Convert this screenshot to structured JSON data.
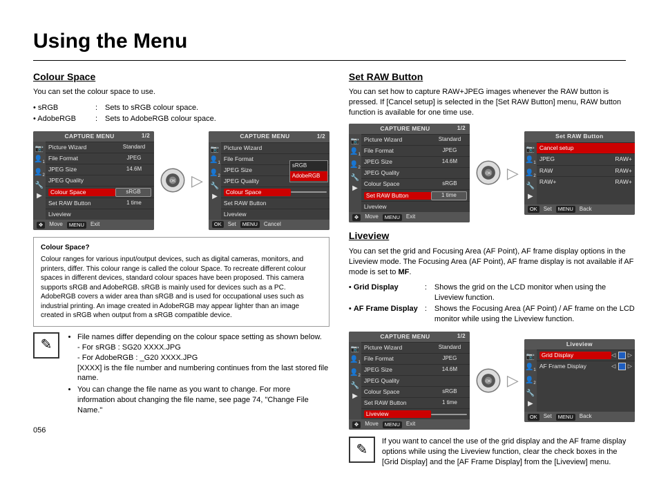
{
  "page": {
    "title": "Using the Menu",
    "number": "056"
  },
  "left": {
    "colourSpace": {
      "title": "Colour Space",
      "intro": "You can set the colour space to use.",
      "defs": [
        {
          "term": "• sRGB",
          "colon": ":",
          "desc": "Sets to sRGB colour space."
        },
        {
          "term": "• AdobeRGB",
          "colon": ":",
          "desc": "Sets to AdobeRGB colour space."
        }
      ],
      "menu1": {
        "head": "CAPTURE MENU",
        "page": "1/2",
        "rows": [
          {
            "label": "Picture Wizard",
            "val": "Standard"
          },
          {
            "label": "File Format",
            "val": "JPEG"
          },
          {
            "label": "JPEG Size",
            "val": "14.6M"
          },
          {
            "label": "JPEG Quality",
            "val": ""
          },
          {
            "label": "Colour Space",
            "val": "sRGB",
            "sel": true
          },
          {
            "label": "Set RAW Button",
            "val": "1 time"
          },
          {
            "label": "Liveview",
            "val": ""
          }
        ],
        "foot": {
          "l": "Move",
          "r": "Exit"
        }
      },
      "menu2": {
        "head": "CAPTURE MENU",
        "page": "1/2",
        "rows": [
          {
            "label": "Picture Wizard",
            "val": ""
          },
          {
            "label": "File Format",
            "val": ""
          },
          {
            "label": "JPEG Size",
            "val": ""
          },
          {
            "label": "JPEG Quality",
            "val": ""
          },
          {
            "label": "Colour Space",
            "val": "",
            "sel": true
          },
          {
            "label": "Set RAW Button",
            "val": ""
          },
          {
            "label": "Liveview",
            "val": ""
          }
        ],
        "popup": [
          "sRGB",
          "AdobeRGB"
        ],
        "foot": {
          "l": "Set",
          "r": "Cancel"
        }
      },
      "box": {
        "title": "Colour Space?",
        "text": "Colour ranges for various input/output devices, such as digital cameras, monitors, and printers, differ. This colour range is called the colour Space. To recreate different colour spaces in different devices, standard colour spaces have been proposed. This camera supports sRGB and AdobeRGB. sRGB is mainly used for devices such as a PC. AdobeRGB covers a wider area than sRGB and is used for occupational uses such as industrial printing. An image created in AdobeRGB may appear lighter than an image created in sRGB when output from a sRGB compatible device."
      },
      "note": {
        "bullet1": "File names differ depending on the colour space setting as shown below.",
        "sub1": "- For sRGB : SG20 XXXX.JPG",
        "sub2": "- For AdobeRGB : _G20 XXXX.JPG",
        "sub3": "[XXXX] is the file number and numbering continues from the last stored file name.",
        "bullet2": "You can change the file name as you want to change. For more information about changing the file name, see page 74, \"Change File Name.\""
      }
    }
  },
  "right": {
    "setRaw": {
      "title": "Set RAW Button",
      "intro": "You can set how to capture RAW+JPEG images whenever the RAW button is pressed. If [Cancel setup] is selected in the [Set RAW Button] menu, RAW button function is available for one time use.",
      "menu": {
        "head": "CAPTURE MENU",
        "page": "1/2",
        "rows": [
          {
            "label": "Picture Wizard",
            "val": "Standard"
          },
          {
            "label": "File Format",
            "val": "JPEG"
          },
          {
            "label": "JPEG Size",
            "val": "14.6M"
          },
          {
            "label": "JPEG Quality",
            "val": ""
          },
          {
            "label": "Colour Space",
            "val": "sRGB"
          },
          {
            "label": "Set RAW Button",
            "val": "1 time",
            "sel": true
          },
          {
            "label": "Liveview",
            "val": ""
          }
        ],
        "foot": {
          "l": "Move",
          "r": "Exit"
        }
      },
      "submenu": {
        "head": "Set RAW Button",
        "rows": [
          {
            "label": "Cancel setup",
            "val": "",
            "sel": true
          },
          {
            "label": "JPEG",
            "val": "RAW+"
          },
          {
            "label": "RAW",
            "val": "RAW+"
          },
          {
            "label": "RAW+",
            "val": "RAW+"
          }
        ],
        "foot": {
          "l": "Set",
          "r": "Back"
        }
      }
    },
    "liveview": {
      "title": "Liveview",
      "intro": "You can set the grid and Focusing Area (AF Point), AF frame display options in the Liveview mode. The Focusing Area (AF Point), AF frame display is not available if AF mode is set to ",
      "introBold": "MF",
      "introEnd": ".",
      "defs": [
        {
          "termBold": "Grid Display",
          "colon": ":",
          "desc": "Shows the grid on the LCD monitor when using the Liveview function."
        },
        {
          "termBold": "AF Frame Display",
          "colon": ":",
          "desc": "Shows the Focusing Area (AF Point) / AF frame on the LCD monitor while using the Liveview function."
        }
      ],
      "menu": {
        "head": "CAPTURE MENU",
        "page": "1/2",
        "rows": [
          {
            "label": "Picture Wizard",
            "val": "Standard"
          },
          {
            "label": "File Format",
            "val": "JPEG"
          },
          {
            "label": "JPEG Size",
            "val": "14.6M"
          },
          {
            "label": "JPEG Quality",
            "val": ""
          },
          {
            "label": "Colour Space",
            "val": "sRGB"
          },
          {
            "label": "Set RAW Button",
            "val": "1 time"
          },
          {
            "label": "Liveview",
            "val": "",
            "sel": true
          }
        ],
        "foot": {
          "l": "Move",
          "r": "Exit"
        }
      },
      "submenu": {
        "head": "Liveview",
        "rows": [
          {
            "label": "Grid Display",
            "chk": true,
            "sel": true
          },
          {
            "label": "AF Frame Display",
            "chk": true
          }
        ],
        "foot": {
          "l": "Set",
          "r": "Back"
        }
      },
      "note": "If you want to cancel the use of the grid display and the AF frame display options while using the Liveview function, clear the check boxes in the [Grid Display] and the [AF Frame Display] from the [Liveview] menu."
    }
  },
  "glyphs": {
    "ok": "OK",
    "menu": "MENU",
    "pencil": "✎",
    "camera": "📷",
    "person": "👤",
    "play": "▶",
    "wrench": "🔧",
    "arrows4": "✥",
    "arrowR": "▷"
  }
}
